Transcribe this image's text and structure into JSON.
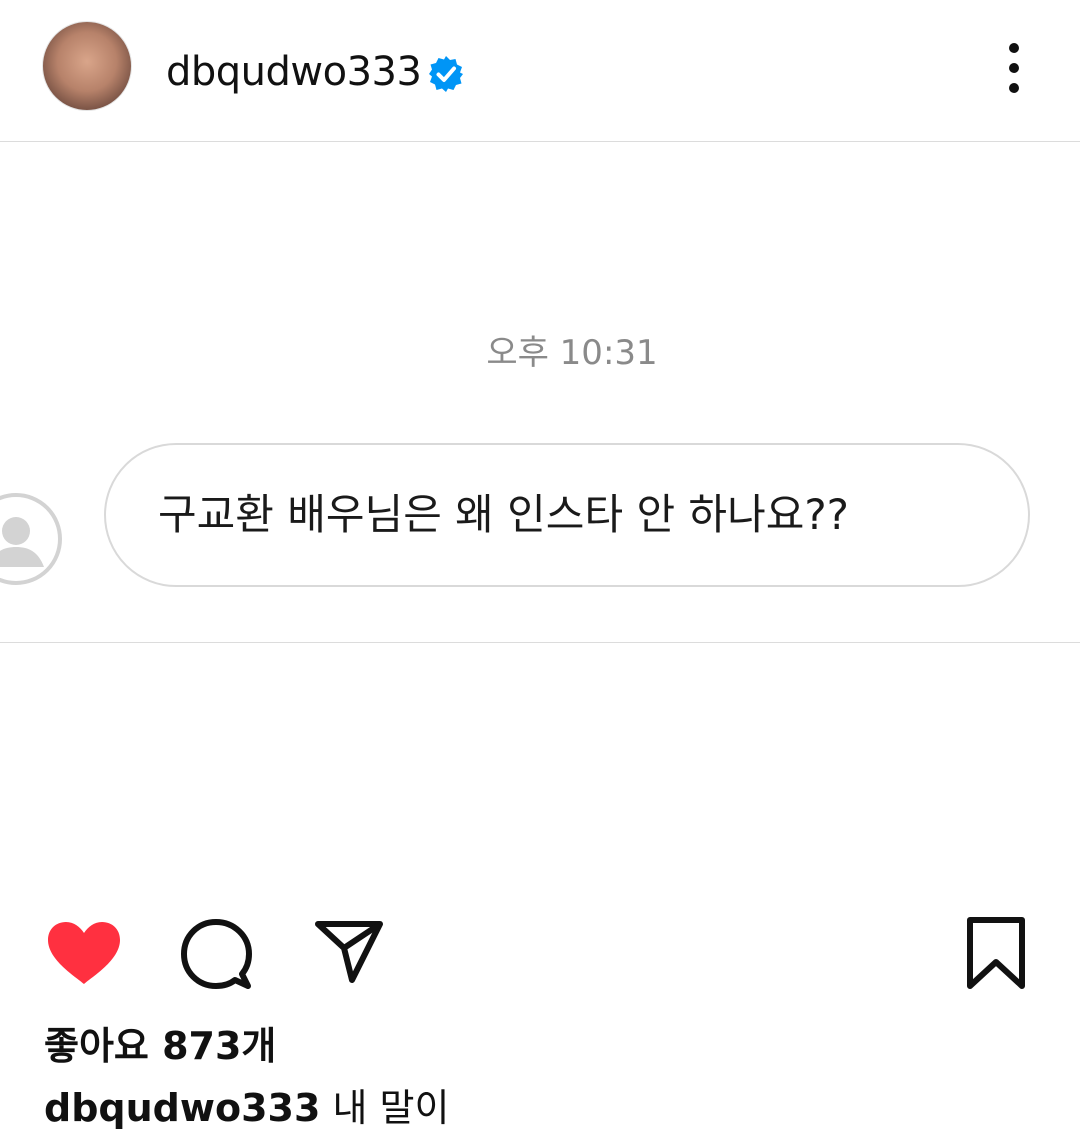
{
  "post": {
    "username": "dbqudwo333",
    "verified": true
  },
  "chat": {
    "timestamp": "오후 10:31",
    "message": "구교환 배우님은 왜 인스타 안 하나요??"
  },
  "stats": {
    "likes_text": "좋아요 873개"
  },
  "caption": {
    "username": "dbqudwo333",
    "text": "내 말이"
  },
  "icons": {
    "verified": "verified-badge-icon",
    "more": "more-options-icon",
    "like": "heart-icon",
    "comment": "comment-icon",
    "share": "send-icon",
    "save": "bookmark-icon"
  },
  "colors": {
    "like_red": "#ff3040",
    "verified_blue": "#0095f6"
  }
}
